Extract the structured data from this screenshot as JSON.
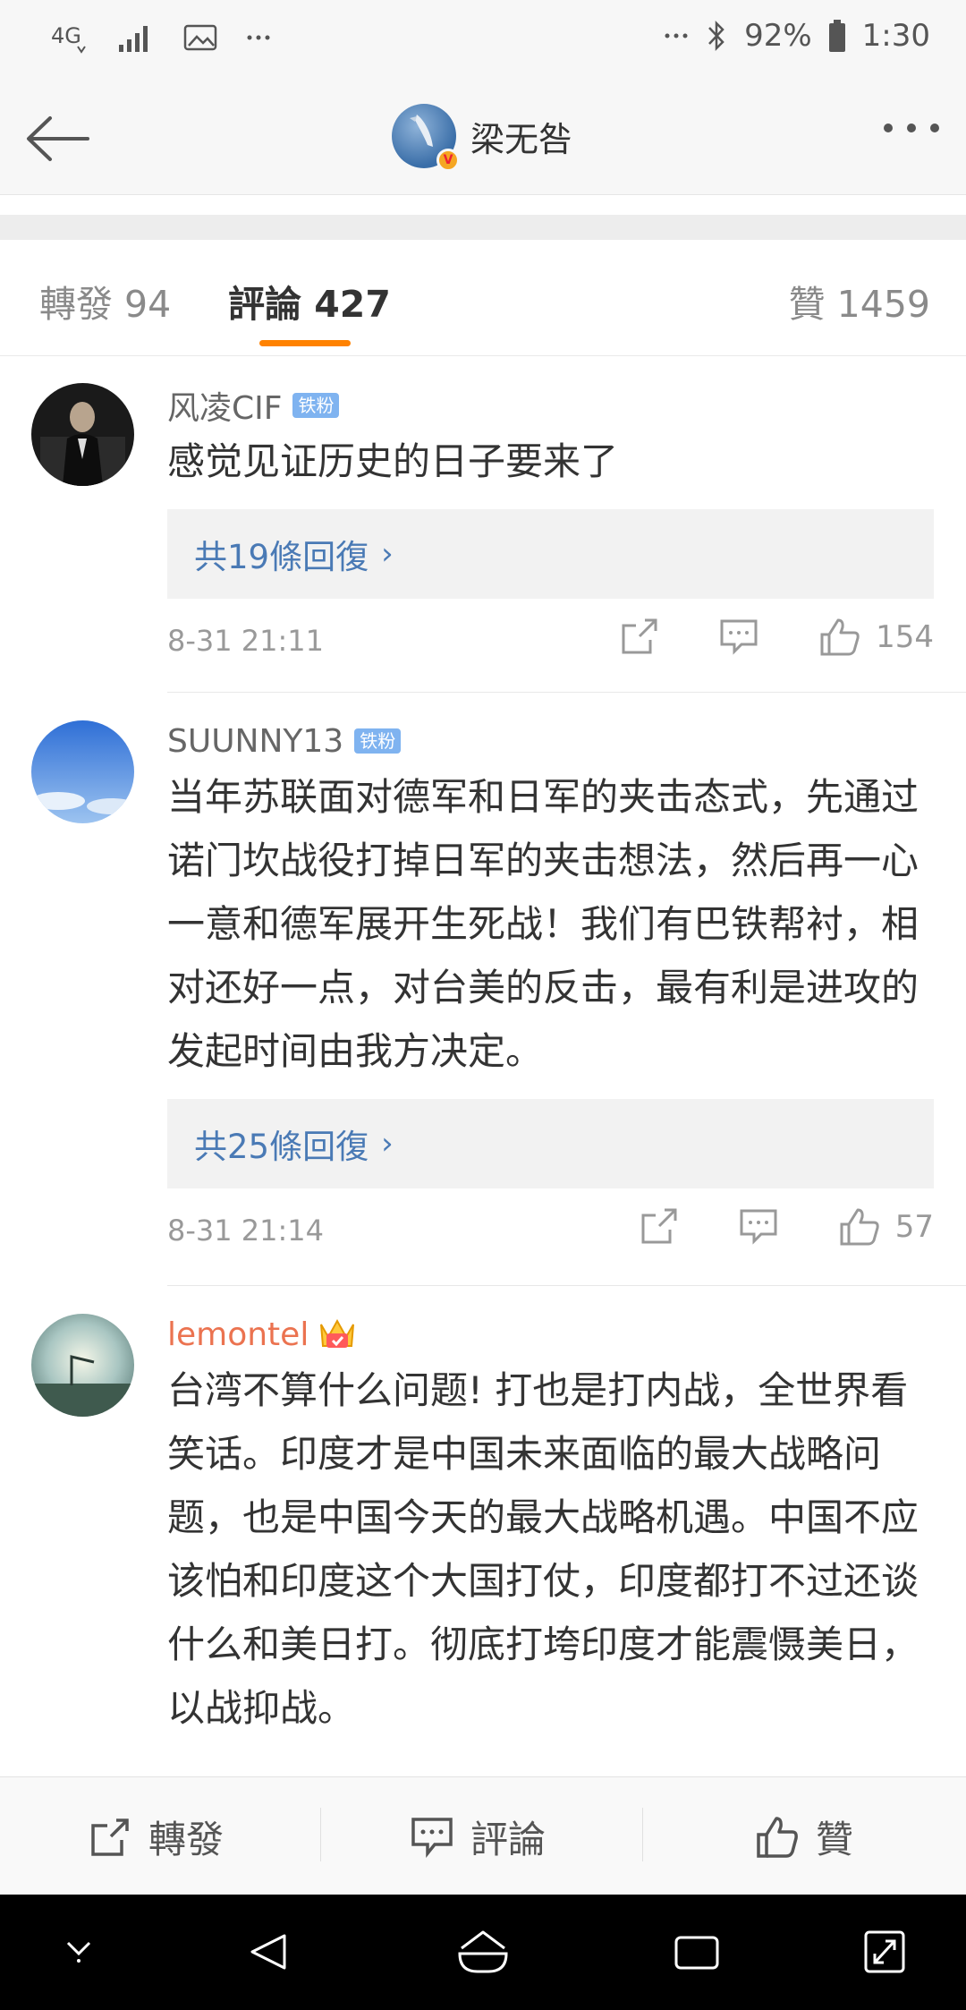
{
  "status_bar": {
    "network": "4G",
    "battery": "92%",
    "time": "1:30",
    "left_icons": [
      "network-4g-icon",
      "signal-icon",
      "image-icon",
      "more-dots-icon"
    ],
    "right_icons": [
      "more-dots-icon",
      "bluetooth-icon",
      "battery-icon"
    ]
  },
  "nav": {
    "title": "梁无咎",
    "verified_badge": "V",
    "back_icon": "back-arrow-icon",
    "more_icon": "more-horizontal-icon"
  },
  "tabs": [
    {
      "label": "轉發 94",
      "active": false
    },
    {
      "label": "評論 427",
      "active": true
    },
    {
      "label": "贊 1459",
      "active": false
    }
  ],
  "accent_color": "#ff8200",
  "comments": [
    {
      "user": "风凌CIF",
      "badge": "铁粉",
      "text": "感觉见证历史的日子要来了",
      "replies": "共19條回復",
      "time": "8-31 21:11",
      "likes": "154"
    },
    {
      "user": "SUUNNY13",
      "badge": "铁粉",
      "text": "当年苏联面对德军和日军的夹击态式，先通过诺门坎战役打掉日军的夹击想法，然后再一心一意和德军展开生死战！我们有巴铁帮衬，相对还好一点，对台美的反击，最有利是进攻的发起时间由我方决定。",
      "replies": "共25條回復",
      "time": "8-31 21:14",
      "likes": "57"
    },
    {
      "user": "lemontel",
      "text": "台湾不算什么问题! 打也是打内战，全世界看笑话。印度才是中国未来面临的最大战略问题，也是中国今天的最大战略机遇。中国不应该怕和印度这个大国打仗，印度都打不过还谈什么和美日打。彻底打垮印度才能震慑美日，以战抑战。"
    }
  ],
  "bottom_bar": {
    "repost": "轉發",
    "comment": "評論",
    "like": "贊"
  },
  "system_nav": [
    "down-chevron-icon",
    "back-triangle-icon",
    "home-icon",
    "recents-icon",
    "expand-icon"
  ]
}
